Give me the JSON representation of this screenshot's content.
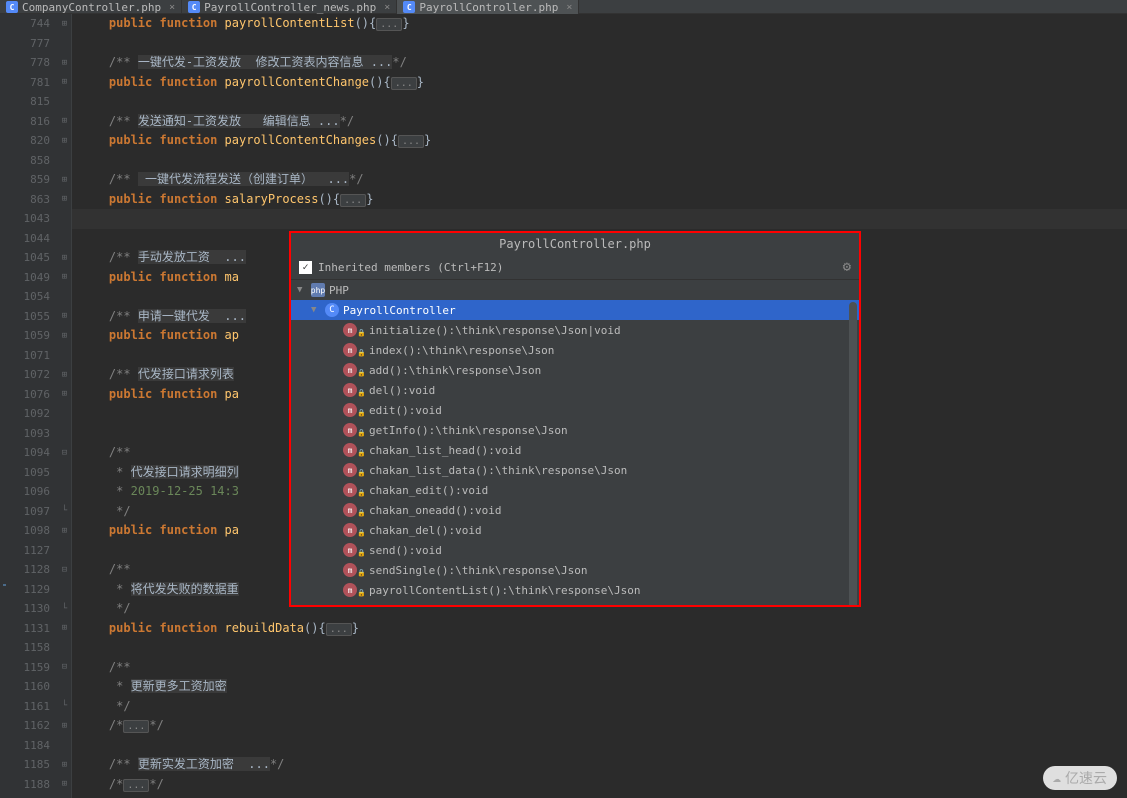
{
  "tabs": [
    {
      "label": "CompanyController.php",
      "active": false
    },
    {
      "label": "PayrollController_news.php",
      "active": false
    },
    {
      "label": "PayrollController.php",
      "active": true
    }
  ],
  "code_lines": [
    {
      "n": "744",
      "fold": "+",
      "tokens": [
        [
          "",
          "    "
        ],
        [
          "kw",
          "public"
        ],
        [
          "",
          " "
        ],
        [
          "kw",
          "function"
        ],
        [
          "",
          " "
        ],
        [
          "fn",
          "payrollContentList"
        ],
        [
          "",
          "(){"
        ],
        [
          "fold",
          "..."
        ],
        [
          "",
          "}"
        ]
      ]
    },
    {
      "n": "777",
      "tokens": []
    },
    {
      "n": "778",
      "fold": "+",
      "tokens": [
        [
          "",
          "    "
        ],
        [
          "cm",
          "/** "
        ],
        [
          "cm-hl",
          "一键代发-工资发放  修改工资表内容信息 ..."
        ],
        [
          "cm",
          "*/"
        ]
      ]
    },
    {
      "n": "781",
      "fold": "+",
      "tokens": [
        [
          "",
          "    "
        ],
        [
          "kw",
          "public"
        ],
        [
          "",
          " "
        ],
        [
          "kw",
          "function"
        ],
        [
          "",
          " "
        ],
        [
          "fn",
          "payrollContentChange"
        ],
        [
          "",
          "(){"
        ],
        [
          "fold",
          "..."
        ],
        [
          "",
          "}"
        ]
      ]
    },
    {
      "n": "815",
      "tokens": []
    },
    {
      "n": "816",
      "fold": "+",
      "tokens": [
        [
          "",
          "    "
        ],
        [
          "cm",
          "/** "
        ],
        [
          "cm-hl",
          "发送通知-工资发放   编辑信息 ..."
        ],
        [
          "cm",
          "*/"
        ]
      ]
    },
    {
      "n": "820",
      "fold": "+",
      "tokens": [
        [
          "",
          "    "
        ],
        [
          "kw",
          "public"
        ],
        [
          "",
          " "
        ],
        [
          "kw",
          "function"
        ],
        [
          "",
          " "
        ],
        [
          "fn",
          "payrollContentChanges"
        ],
        [
          "",
          "(){"
        ],
        [
          "fold",
          "..."
        ],
        [
          "",
          "}"
        ]
      ]
    },
    {
      "n": "858",
      "tokens": []
    },
    {
      "n": "859",
      "fold": "+",
      "tokens": [
        [
          "",
          "    "
        ],
        [
          "cm",
          "/** "
        ],
        [
          "cm-hl",
          " 一键代发流程发送（创建订单）  ..."
        ],
        [
          "cm",
          "*/"
        ]
      ]
    },
    {
      "n": "863",
      "fold": "+",
      "tokens": [
        [
          "",
          "    "
        ],
        [
          "kw",
          "public"
        ],
        [
          "",
          " "
        ],
        [
          "kw",
          "function"
        ],
        [
          "",
          " "
        ],
        [
          "fn",
          "salaryProcess"
        ],
        [
          "",
          "(){"
        ],
        [
          "fold",
          "..."
        ],
        [
          "",
          "}"
        ]
      ]
    },
    {
      "n": "1043",
      "highlight": true,
      "tokens": []
    },
    {
      "n": "1044",
      "tokens": []
    },
    {
      "n": "1045",
      "fold": "+",
      "tokens": [
        [
          "",
          "    "
        ],
        [
          "cm",
          "/** "
        ],
        [
          "cm-hl",
          "手动发放工资  ..."
        ]
      ]
    },
    {
      "n": "1049",
      "fold": "+",
      "tokens": [
        [
          "",
          "    "
        ],
        [
          "kw",
          "public"
        ],
        [
          "",
          " "
        ],
        [
          "kw",
          "function"
        ],
        [
          "",
          " "
        ],
        [
          "fn",
          "ma"
        ]
      ]
    },
    {
      "n": "1054",
      "tokens": []
    },
    {
      "n": "1055",
      "fold": "+",
      "tokens": [
        [
          "",
          "    "
        ],
        [
          "cm",
          "/** "
        ],
        [
          "cm-hl",
          "申请一键代发  ..."
        ]
      ]
    },
    {
      "n": "1059",
      "fold": "+",
      "tokens": [
        [
          "",
          "    "
        ],
        [
          "kw",
          "public"
        ],
        [
          "",
          " "
        ],
        [
          "kw",
          "function"
        ],
        [
          "",
          " "
        ],
        [
          "fn",
          "ap"
        ]
      ]
    },
    {
      "n": "1071",
      "tokens": []
    },
    {
      "n": "1072",
      "fold": "+",
      "tokens": [
        [
          "",
          "    "
        ],
        [
          "cm",
          "/** "
        ],
        [
          "cm-hl",
          "代发接口请求列表"
        ]
      ]
    },
    {
      "n": "1076",
      "fold": "+",
      "tokens": [
        [
          "",
          "    "
        ],
        [
          "kw",
          "public"
        ],
        [
          "",
          " "
        ],
        [
          "kw",
          "function"
        ],
        [
          "",
          " "
        ],
        [
          "fn",
          "pa"
        ]
      ]
    },
    {
      "n": "1092",
      "tokens": []
    },
    {
      "n": "1093",
      "tokens": []
    },
    {
      "n": "1094",
      "fold": "-",
      "tokens": [
        [
          "",
          "    "
        ],
        [
          "cm",
          "/**"
        ]
      ]
    },
    {
      "n": "1095",
      "tokens": [
        [
          "",
          "    "
        ],
        [
          "cm",
          " * "
        ],
        [
          "cm-hl",
          "代发接口请求明细列"
        ]
      ]
    },
    {
      "n": "1096",
      "tokens": [
        [
          "",
          "    "
        ],
        [
          "cm",
          " * "
        ],
        [
          "str",
          "2019-12-25 14:3"
        ]
      ]
    },
    {
      "n": "1097",
      "fold": "_",
      "tokens": [
        [
          "",
          "    "
        ],
        [
          "cm",
          " */"
        ]
      ]
    },
    {
      "n": "1098",
      "fold": "+",
      "tokens": [
        [
          "",
          "    "
        ],
        [
          "kw",
          "public"
        ],
        [
          "",
          " "
        ],
        [
          "kw",
          "function"
        ],
        [
          "",
          " "
        ],
        [
          "fn",
          "pa"
        ]
      ]
    },
    {
      "n": "1127",
      "tokens": []
    },
    {
      "n": "1128",
      "fold": "-",
      "tokens": [
        [
          "",
          "    "
        ],
        [
          "cm",
          "/**"
        ]
      ]
    },
    {
      "n": "1129",
      "tokens": [
        [
          "",
          "    "
        ],
        [
          "cm",
          " * "
        ],
        [
          "cm-hl",
          "将代发失败的数据重"
        ]
      ]
    },
    {
      "n": "1130",
      "fold": "_",
      "tokens": [
        [
          "",
          "    "
        ],
        [
          "cm",
          " */"
        ]
      ]
    },
    {
      "n": "1131",
      "fold": "+",
      "tokens": [
        [
          "",
          "    "
        ],
        [
          "kw",
          "public"
        ],
        [
          "",
          " "
        ],
        [
          "kw",
          "function"
        ],
        [
          "",
          " "
        ],
        [
          "fn",
          "rebuildData"
        ],
        [
          "",
          "(){"
        ],
        [
          "fold",
          "..."
        ],
        [
          "",
          "}"
        ]
      ]
    },
    {
      "n": "1158",
      "tokens": []
    },
    {
      "n": "1159",
      "fold": "-",
      "tokens": [
        [
          "",
          "    "
        ],
        [
          "cm",
          "/**"
        ]
      ]
    },
    {
      "n": "1160",
      "tokens": [
        [
          "",
          "    "
        ],
        [
          "cm",
          " * "
        ],
        [
          "cm-hl",
          "更新更多工资加密"
        ]
      ]
    },
    {
      "n": "1161",
      "fold": "_",
      "tokens": [
        [
          "",
          "    "
        ],
        [
          "cm",
          " */"
        ]
      ]
    },
    {
      "n": "1162",
      "fold": "+",
      "tokens": [
        [
          "",
          "    "
        ],
        [
          "cm",
          "/*"
        ],
        [
          "fold",
          "..."
        ],
        [
          "cm",
          "*/"
        ]
      ]
    },
    {
      "n": "1184",
      "tokens": []
    },
    {
      "n": "1185",
      "fold": "+",
      "tokens": [
        [
          "",
          "    "
        ],
        [
          "cm",
          "/** "
        ],
        [
          "cm-hl",
          "更新实发工资加密  ..."
        ],
        [
          "cm",
          "*/"
        ]
      ]
    },
    {
      "n": "1188",
      "fold": "+",
      "tokens": [
        [
          "",
          "    "
        ],
        [
          "cm",
          "/*"
        ],
        [
          "fold",
          "..."
        ],
        [
          "cm",
          "*/"
        ]
      ]
    }
  ],
  "popup": {
    "title": "PayrollController.php",
    "checkbox_label": "Inherited members (Ctrl+F12)",
    "root": "PHP",
    "class_name": "PayrollController",
    "members": [
      "initialize():\\think\\response\\Json|void",
      "index():\\think\\response\\Json",
      "add():\\think\\response\\Json",
      "del():void",
      "edit():void",
      "getInfo():\\think\\response\\Json",
      "chakan_list_head():void",
      "chakan_list_data():\\think\\response\\Json",
      "chakan_edit():void",
      "chakan_oneadd():void",
      "chakan_del():void",
      "send():void",
      "sendSingle():\\think\\response\\Json",
      "payrollContentList():\\think\\response\\Json"
    ]
  },
  "watermark": "亿速云"
}
